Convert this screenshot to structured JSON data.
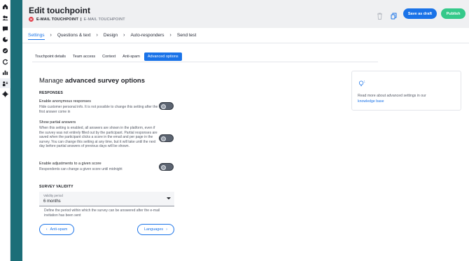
{
  "rail": {
    "icons": [
      "home-icon",
      "users-icon",
      "chat-icon",
      "chart-pie-icon",
      "check-circle-icon",
      "refresh-icon",
      "bar-chart-icon",
      "touchpoint-icon",
      "gear-icon"
    ]
  },
  "header": {
    "title": "Edit touchpoint",
    "kind": "E-MAIL TOUCHPOINT",
    "separator": "|",
    "name": "E-MAIL TOUCHPOINT",
    "save_draft": "Save as draft",
    "publish": "Publish"
  },
  "steps": [
    "Settings",
    "Questions & text",
    "Design",
    "Auto-responders",
    "Send test"
  ],
  "tabs": [
    "Touchpoint details",
    "Team access",
    "Context",
    "Anti-spam",
    "Advanced options"
  ],
  "content": {
    "heading_prefix": "Manage ",
    "heading_bold": "advanced survey options",
    "responses_section": "RESPONSES",
    "options": [
      {
        "title": "Enable anonymous responses",
        "desc": "Hide customer personal info. It is not possible to change this setting after the first answer come in",
        "enabled": false
      },
      {
        "title": "Show partial answers",
        "desc": "When this setting is enabled, all answers are shown in the platform, even if the survey was not entirely filled out by the participant. Partial responses are saved when the participant clicks a score in the email and per page in the survey. You can change this setting at any time, but it will take until the next day before partial answers of previous days will be shown.",
        "enabled": false
      },
      {
        "title": "Enable adjustments to a given score",
        "desc": "Respondents can change a given score until midnight",
        "enabled": false
      }
    ],
    "validity_section": "SURVEY VALIDITY",
    "validity_label": "Validity period",
    "validity_value": "6 months",
    "validity_help": "Define the period within which the survey can be answered after the e-mail invitation has been sent",
    "prev_button": "Anti-spam",
    "next_button": "Languages"
  },
  "info_card": {
    "text": "Read more about advanced settings in our",
    "link": "knowledge base"
  },
  "colors": {
    "accent": "#1a73e8",
    "publish": "#35c98a",
    "rail_teal": "#1c6e78",
    "badge_red": "#e23a46"
  }
}
